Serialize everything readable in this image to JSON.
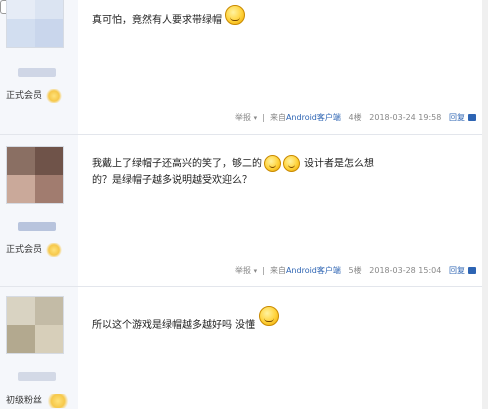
{
  "posts": [
    {
      "content_parts": [
        "真可怕，竟然有人要求带绿帽"
      ],
      "member_label": "正式会员",
      "meta": {
        "report": "举报",
        "source": "来自",
        "client": "Android客户端",
        "floor": "4楼",
        "time": "2018-03-24 19:58",
        "reply": "回复"
      }
    },
    {
      "content_parts": [
        "我戴上了绿帽子还高兴的笑了，够二的",
        "设计者是怎么想的？是绿帽子越多说明越受欢迎么？"
      ],
      "member_label": "正式会员",
      "meta": {
        "report": "举报",
        "source": "来自",
        "client": "Android客户端",
        "floor": "5楼",
        "time": "2018-03-28 15:04",
        "reply": "回复"
      }
    },
    {
      "content_parts": [
        "所以这个游戏是绿帽越多越好吗 没懂"
      ],
      "member_label": "初级粉丝"
    }
  ],
  "icons": {
    "emoji": "smiley-emoji-icon",
    "reply": "reply-icon",
    "badge": "gold-badge-icon"
  },
  "colors": {
    "link": "#2d64b3",
    "meta_text": "#888888",
    "sidebar_bg": "#f5f7fb"
  }
}
